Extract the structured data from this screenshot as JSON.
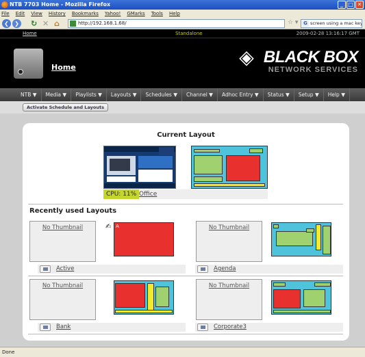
{
  "window": {
    "title": "NTB 7703 Home - Mozilla Firefox"
  },
  "menubar": [
    "File",
    "Edit",
    "View",
    "History",
    "Bookmarks",
    "Yahoo!",
    "GMarks",
    "Tools",
    "Help"
  ],
  "toolbar": {
    "url": "http://192.168.1.68/",
    "search": "screen using a mac keyboard"
  },
  "toplinks": {
    "home": "Home",
    "mode": "Standalone",
    "timestamp": "2009-02-28 13:16:17 GMT"
  },
  "header": {
    "title": "Home",
    "brand": "BLACK BOX",
    "brand_sub": "NETWORK SERVICES"
  },
  "nav": [
    "NTB ▼",
    "Media ▼",
    "Playlists ▼",
    "Layouts ▼",
    "Schedules ▼",
    "Channel ▼",
    "Adhoc Entry ▼",
    "Status ▼",
    "Setup ▼",
    "Help ▼"
  ],
  "activate_label": "Activate Schedule and Layouts",
  "current": {
    "title": "Current Layout",
    "cpu": "CPU: 11%",
    "layout": "Office"
  },
  "recent": {
    "title": "Recently used Layouts",
    "no_thumb": "No Thumbnail",
    "items": [
      {
        "name": "Active"
      },
      {
        "name": "Agenda"
      },
      {
        "name": "Bank"
      },
      {
        "name": "Corporate3"
      }
    ]
  },
  "statusbar": "Done",
  "colors": {
    "accent": "#4fc3dc",
    "red": "#e8312f",
    "green": "#9fd16f",
    "yellow": "#f2ea2a",
    "cpu": "#c4d62c"
  }
}
